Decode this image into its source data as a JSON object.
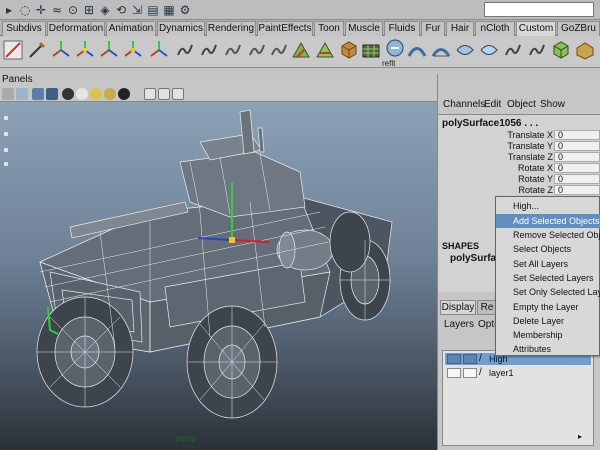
{
  "shelf_tabs": [
    "Subdivs",
    "Deformation",
    "Animation",
    "Dynamics",
    "Rendering",
    "PaintEffects",
    "Toon",
    "Muscle",
    "Fluids",
    "Fur",
    "Hair",
    "nCloth",
    "Custom",
    "GoZBru"
  ],
  "active_tab": "Custom",
  "shelf_item_label": "reflt",
  "panels_menu": "Panels",
  "viewport_label": "persp",
  "channel_box": {
    "menu": [
      "Channels",
      "Edit",
      "Object",
      "Show"
    ],
    "object_name": "polySurface1056 . . .",
    "attributes": [
      {
        "label": "Translate X",
        "value": "0"
      },
      {
        "label": "Translate Y",
        "value": "0"
      },
      {
        "label": "Translate Z",
        "value": "0"
      },
      {
        "label": "Rotate X",
        "value": "0"
      },
      {
        "label": "Rotate Y",
        "value": "0"
      },
      {
        "label": "Rotate Z",
        "value": "0"
      }
    ],
    "shapes_label": "SHAPES",
    "shape_name": "polySurfaceS"
  },
  "layer_editor": {
    "tabs": [
      "Display",
      "Re"
    ],
    "menu": [
      "Layers",
      "Optio"
    ],
    "layers": [
      {
        "name": "High",
        "selected": true
      },
      {
        "name": "layer1",
        "selected": false
      }
    ]
  },
  "context_menu": {
    "items": [
      "High...",
      "Add Selected Objects",
      "Remove Selected Objects",
      "Select Objects",
      "Set All Layers",
      "Set Selected Layers",
      "Set Only Selected Layers",
      "Empty the Layer",
      "Delete Layer",
      "Membership",
      "Attributes"
    ],
    "highlighted": "Add Selected Objects"
  },
  "colors": {
    "highlight": "#5f8fc2",
    "layer_selected": "#6f9fd1",
    "viewport_top": "#8da2b6",
    "viewport_bottom": "#2b3038",
    "wireframe": "#e8ecf0"
  }
}
